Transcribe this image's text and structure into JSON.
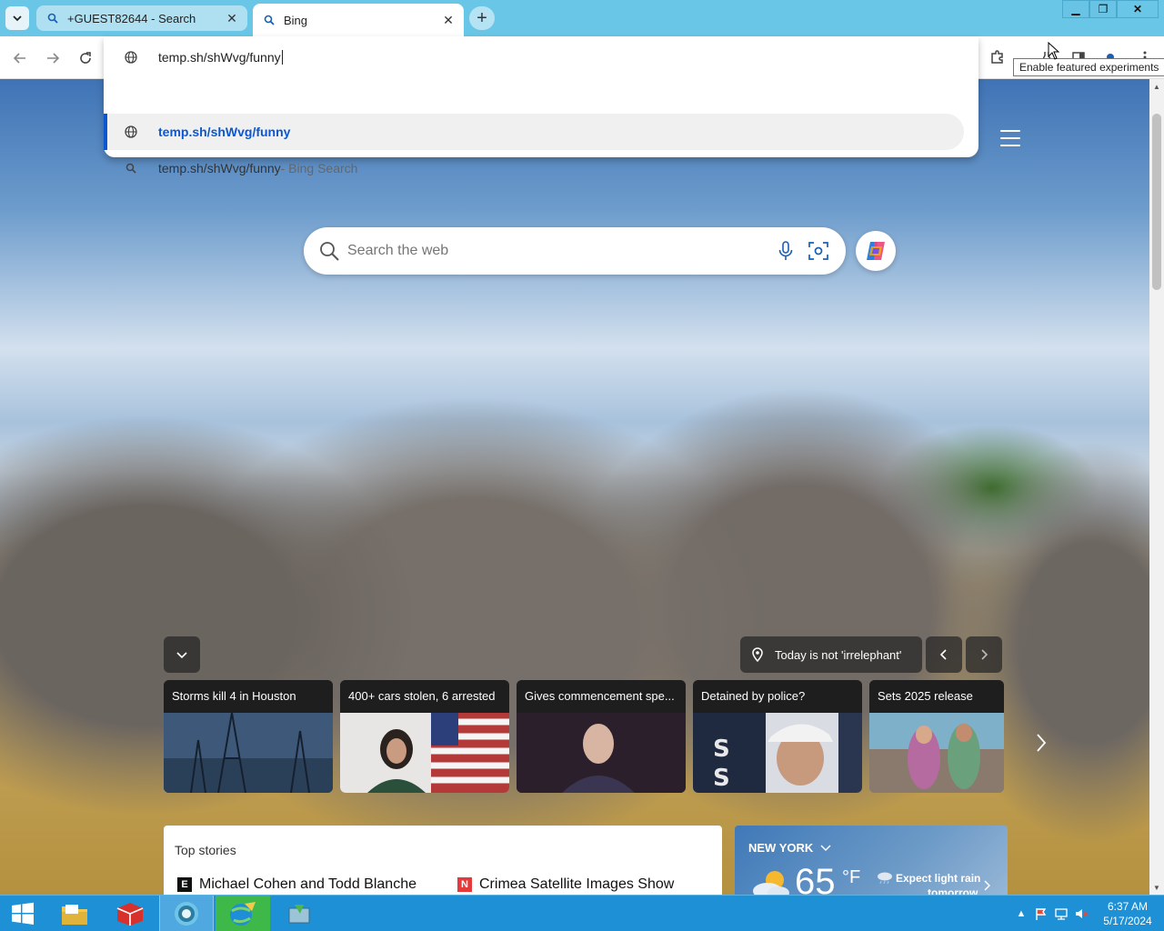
{
  "browser": {
    "tabs": [
      {
        "title": "+GUEST82644 - Search",
        "active": false
      },
      {
        "title": "Bing",
        "active": true
      }
    ],
    "new_tab_symbol": "+",
    "close_symbol": "✕",
    "window_controls": {
      "minimize": "▁",
      "restore": "❐",
      "close": "✕"
    }
  },
  "omnibox": {
    "value": "temp.sh/shWvg/funny",
    "suggestions": [
      {
        "text": "temp.sh/shWvg/funny",
        "suffix": "",
        "icon": "globe-icon",
        "selected": true
      },
      {
        "text": "temp.sh/shWvg/funny",
        "suffix": " - Bing Search",
        "icon": "search-icon",
        "selected": false
      }
    ]
  },
  "tooltip": "Enable featured experiments",
  "bing": {
    "search_placeholder": "Search the web",
    "image_caption": "Today is not 'irrelephant'",
    "news_cards": [
      {
        "title": "Storms kill 4 in Houston"
      },
      {
        "title": "400+ cars stolen, 6 arrested"
      },
      {
        "title": "Gives commencement spe..."
      },
      {
        "title": "Detained by police?"
      },
      {
        "title": "Sets 2025 release"
      }
    ],
    "top_stories": {
      "title": "Top stories",
      "items": [
        {
          "source": "E",
          "headline": "Michael Cohen and Todd Blanche"
        },
        {
          "source": "N",
          "headline": "Crimea Satellite Images Show"
        }
      ]
    },
    "weather": {
      "location": "NEW YORK",
      "temperature": "65",
      "unit": "°F",
      "condition_line1": "Expect light rain",
      "condition_line2": "tomorrow"
    }
  },
  "taskbar": {
    "time": "6:37 AM",
    "date": "5/17/2024"
  },
  "colors": {
    "tabstrip": "#6ac6e6",
    "accent": "#0b57d0",
    "taskbar": "#1e90d6"
  }
}
